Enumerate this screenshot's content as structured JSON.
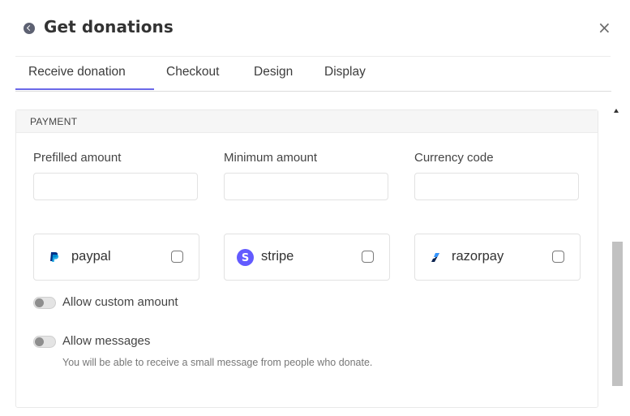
{
  "header": {
    "title": "Get donations",
    "close_glyph": "×"
  },
  "tabs": [
    {
      "label": "Receive donation",
      "active": true
    },
    {
      "label": "Checkout",
      "active": false
    },
    {
      "label": "Design",
      "active": false
    },
    {
      "label": "Display",
      "active": false
    }
  ],
  "section": {
    "title": "PAYMENT",
    "fields": [
      {
        "label": "Prefilled amount",
        "value": "",
        "placeholder": ""
      },
      {
        "label": "Minimum amount",
        "value": "",
        "placeholder": ""
      },
      {
        "label": "Currency code",
        "value": "",
        "placeholder": ""
      }
    ],
    "gateways": [
      {
        "name": "paypal",
        "icon": "paypal-icon",
        "checked": false
      },
      {
        "name": "stripe",
        "icon": "stripe-icon",
        "checked": false
      },
      {
        "name": "razorpay",
        "icon": "razorpay-icon",
        "checked": false
      }
    ],
    "toggles": [
      {
        "label": "Allow custom amount",
        "on": false
      },
      {
        "label": "Allow messages",
        "on": false,
        "help": "You will be able to receive a small message from people who donate."
      }
    ]
  },
  "colors": {
    "accent": "#6a68e8",
    "stripe_brand": "#635bff",
    "paypal_dark": "#003087",
    "paypal_light": "#009cde",
    "razorpay_brand": "#0c2451"
  }
}
